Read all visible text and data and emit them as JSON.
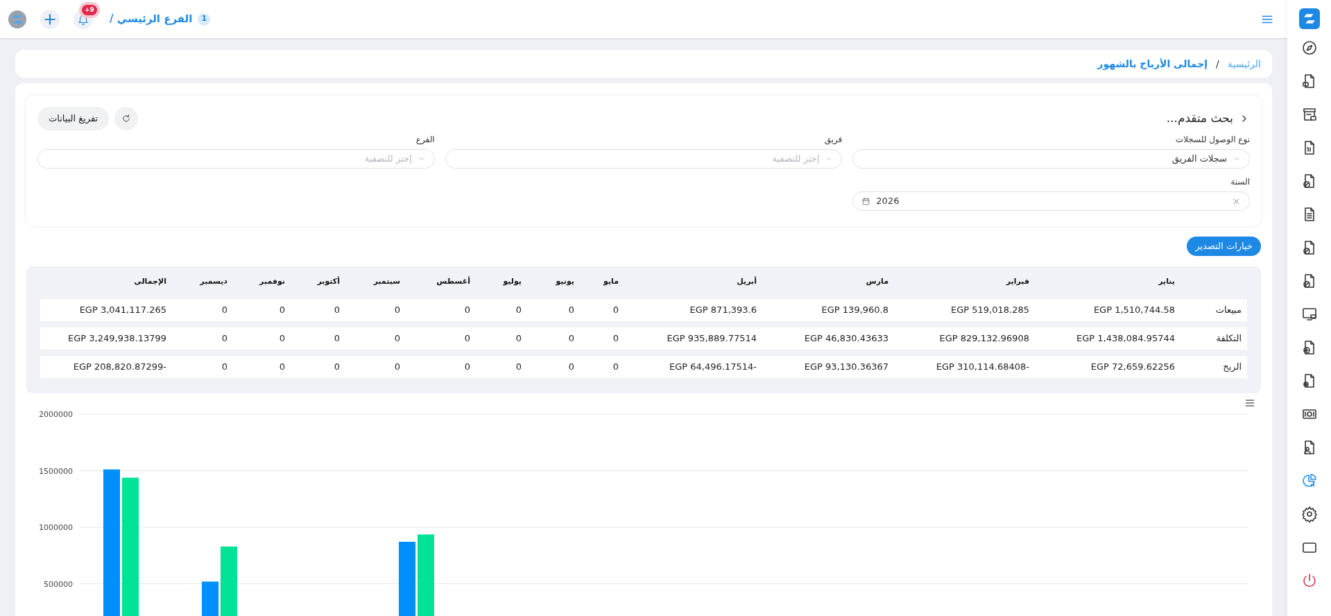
{
  "top_bar": {
    "notification_count": "+9",
    "branch_number": "1",
    "branch": "الفرع الرئيسي /"
  },
  "breadcrumb": {
    "separator": "/",
    "items": [
      {
        "label": "الرئيسية",
        "current": false
      },
      {
        "label": "إجمالى الأرباح بالشهور",
        "current": true
      }
    ]
  },
  "filters": {
    "title": "بحث متقدم...",
    "clear_button": "تفريغ البيانات",
    "fields": [
      {
        "kind": "select",
        "label": "نوع الوصول للسجلات",
        "value": "سجلات الفريق"
      },
      {
        "kind": "select",
        "label": "فريق",
        "placeholder": "إختر للتصفية"
      },
      {
        "kind": "select",
        "label": "الفرع",
        "placeholder": "إختر للتصفية"
      },
      {
        "kind": "date",
        "label": "السنة",
        "value": "2026"
      }
    ]
  },
  "export_button": "خيارات التصدير",
  "table": {
    "columns": [
      "يناير",
      "فبراير",
      "مارس",
      "أبريل",
      "مايو",
      "يونيو",
      "يوليو",
      "أغسطس",
      "سبتمبر",
      "أكتوبر",
      "نوفمبر",
      "ديسمبر",
      "الإجمالى"
    ],
    "rows": [
      {
        "label": "مبيعات",
        "cells": [
          "EGP 1,510,744.58",
          "EGP 519,018.285",
          "EGP 139,960.8",
          "EGP 871,393.6",
          "0",
          "0",
          "0",
          "0",
          "0",
          "0",
          "0",
          "0",
          "EGP 3,041,117.265"
        ]
      },
      {
        "label": "التكلفة",
        "cells": [
          "EGP 1,438,084.95744",
          "EGP 829,132.96908",
          "EGP 46,830.43633",
          "EGP 935,889.77514",
          "0",
          "0",
          "0",
          "0",
          "0",
          "0",
          "0",
          "0",
          "EGP 3,249,938.13799"
        ]
      },
      {
        "label": "الربح",
        "cells": [
          "EGP 72,659.62256",
          "EGP 310,114.68408-",
          "EGP 93,130.36367",
          "EGP 64,496.17514-",
          "0",
          "0",
          "0",
          "0",
          "0",
          "0",
          "0",
          "0",
          "EGP 208,820.87299-"
        ]
      }
    ]
  },
  "chart": {
    "chart_data": {
      "type": "bar",
      "stacked": false,
      "grid": true,
      "ylim": [
        0,
        2000000
      ],
      "yticks": [
        500000,
        1000000,
        1500000,
        2000000
      ],
      "series": [
        {
          "color": "#008ffb",
          "values": [
            1511000,
            519000,
            null,
            871000,
            0,
            0,
            0,
            0,
            0,
            0,
            0,
            0
          ]
        },
        {
          "color": "#00e396",
          "values": [
            1438000,
            829000,
            null,
            936000,
            0,
            0,
            0,
            0,
            0,
            0,
            0,
            0
          ]
        }
      ]
    }
  },
  "sidebar": {
    "items": [
      {
        "selected": false
      },
      {
        "selected": false
      },
      {
        "selected": false
      },
      {
        "selected": false
      },
      {
        "selected": false
      },
      {
        "selected": false
      },
      {
        "selected": false
      },
      {
        "selected": false
      },
      {
        "selected": false
      },
      {
        "selected": false
      },
      {
        "selected": false
      },
      {
        "selected": false
      },
      {
        "selected": false
      },
      {
        "selected": true
      },
      {
        "selected": false
      },
      {
        "selected": false
      },
      {
        "selected": false
      }
    ]
  }
}
